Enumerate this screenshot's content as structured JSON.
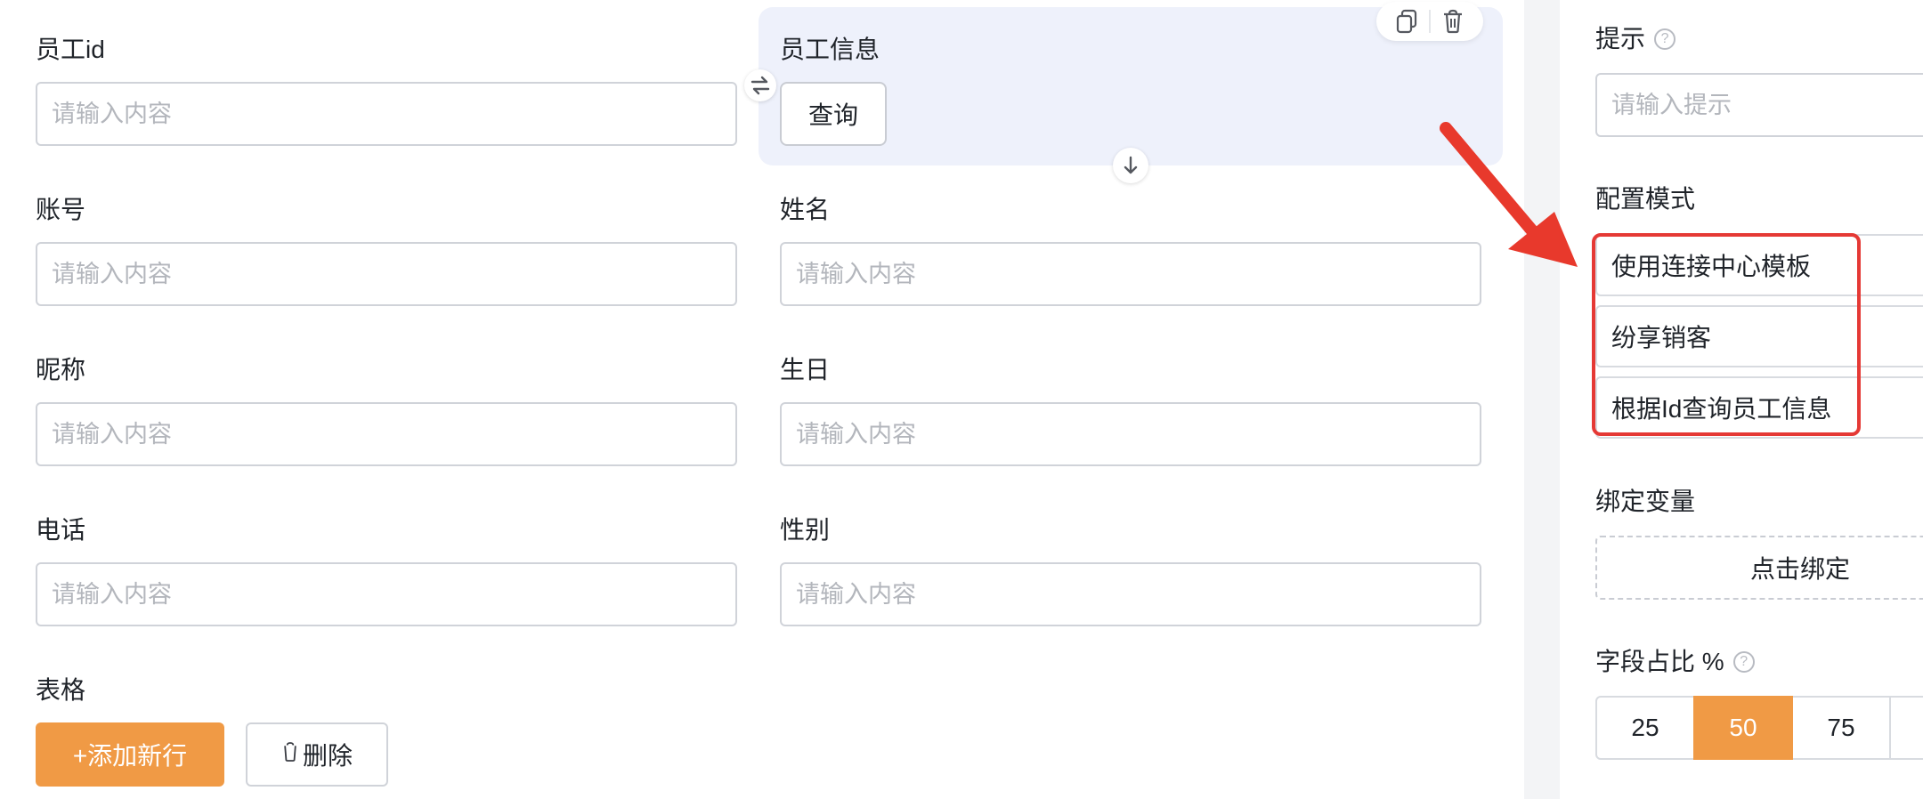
{
  "form": {
    "fields": [
      {
        "label": "员工id",
        "placeholder": "请输入内容"
      },
      {
        "label": "账号",
        "placeholder": "请输入内容"
      },
      {
        "label": "姓名",
        "placeholder": "请输入内容"
      },
      {
        "label": "昵称",
        "placeholder": "请输入内容"
      },
      {
        "label": "生日",
        "placeholder": "请输入内容"
      },
      {
        "label": "电话",
        "placeholder": "请输入内容"
      },
      {
        "label": "性别",
        "placeholder": "请输入内容"
      }
    ],
    "selected_card": {
      "label": "员工信息",
      "button_label": "查询"
    },
    "table": {
      "label": "表格",
      "add_row_label": "+添加新行",
      "delete_label": "删除"
    }
  },
  "properties": {
    "hint": {
      "label": "提示",
      "placeholder": "请输入提示",
      "help_glyph": "?"
    },
    "config_mode": {
      "label": "配置模式",
      "options": [
        "使用连接中心模板",
        "纷享销客",
        "根据Id查询员工信息"
      ]
    },
    "bind_variable": {
      "label": "绑定变量",
      "button_label": "点击绑定"
    },
    "field_ratio": {
      "label": "字段占比 %",
      "help_glyph": "?",
      "options": [
        "25",
        "50",
        "75"
      ],
      "selected": "50"
    }
  },
  "colors": {
    "accent_orange": "#f09a45",
    "selected_card_bg": "#eef1fb",
    "highlight_red": "#e53935"
  },
  "icons": [
    "copy-icon",
    "trash-icon",
    "swap-icon",
    "arrow-down-icon",
    "help-icon",
    "red-arrow-annotation"
  ]
}
